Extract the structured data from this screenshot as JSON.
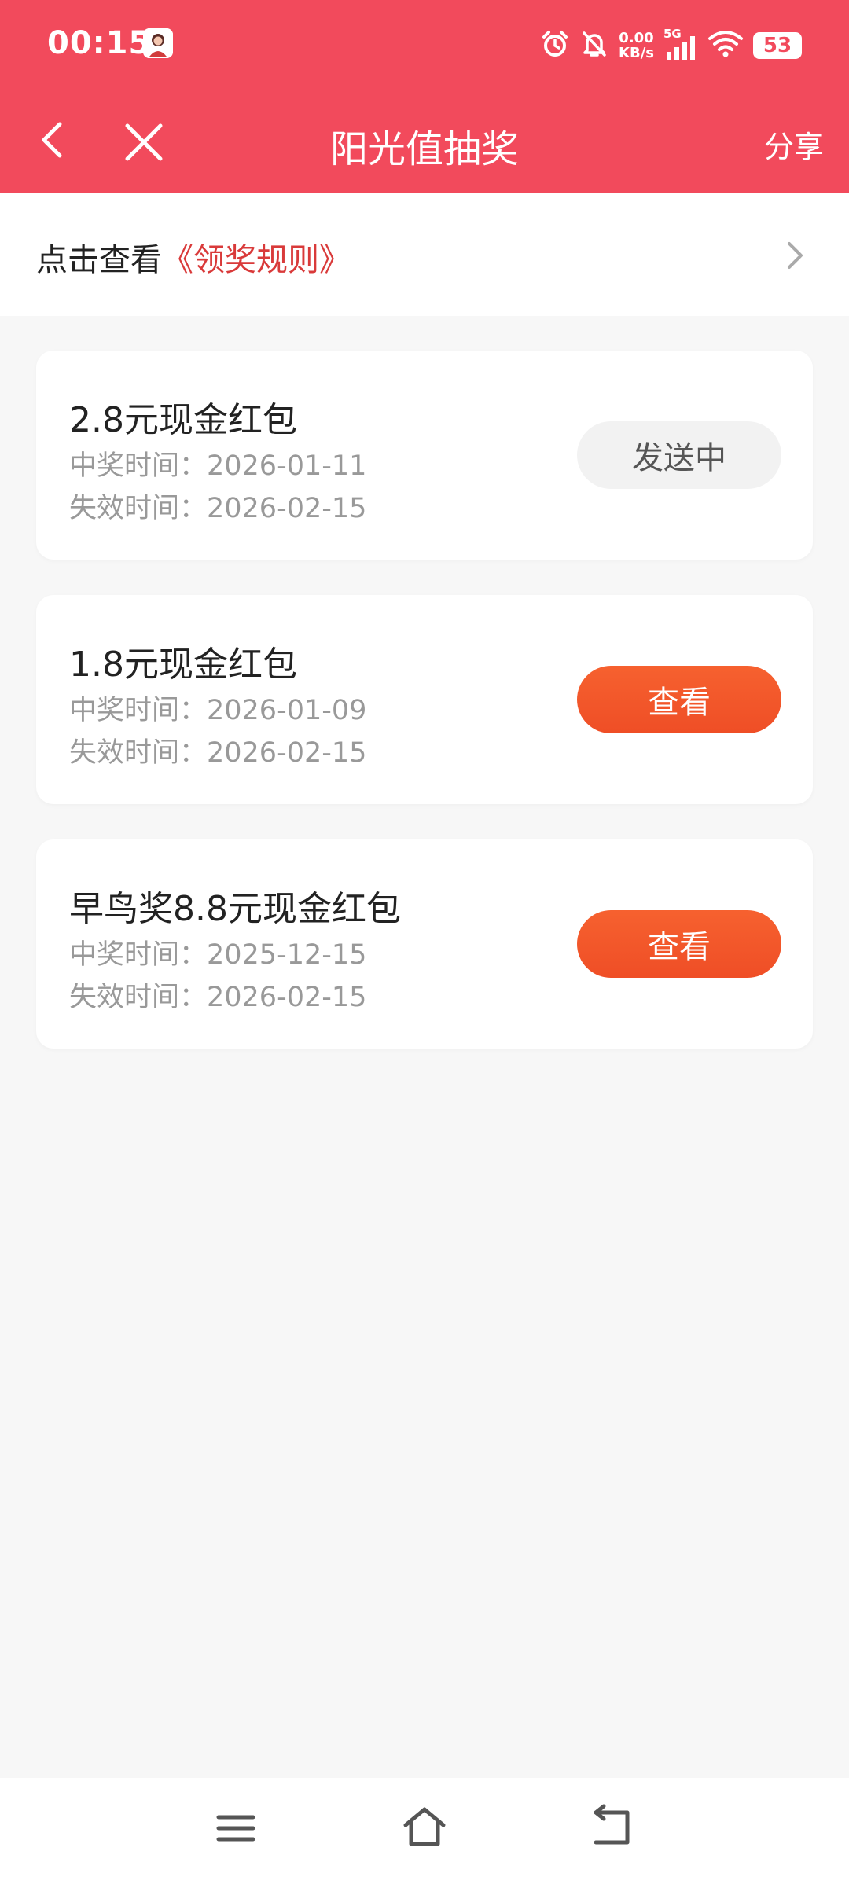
{
  "status_bar": {
    "time": "00:15",
    "net_speed_value": "0.00",
    "net_speed_unit": "KB/s",
    "network_type": "5G",
    "battery": "53"
  },
  "nav": {
    "title": "阳光值抽奖",
    "share_label": "分享"
  },
  "rules": {
    "prefix": "点击查看",
    "link": "《领奖规则》"
  },
  "prizes": [
    {
      "title": "2.8元现金红包",
      "won_time": "中奖时间：2026-01-11",
      "expire_time": "失效时间：2026-02-15",
      "button_label": "发送中"
    },
    {
      "title": "1.8元现金红包",
      "won_time": "中奖时间：2026-01-09",
      "expire_time": "失效时间：2026-02-15",
      "button_label": "查看"
    },
    {
      "title": "早鸟奖8.8元现金红包",
      "won_time": "中奖时间：2025-12-15",
      "expire_time": "失效时间：2026-02-15",
      "button_label": "查看"
    }
  ],
  "colors": {
    "header_bg": "#f24a5c",
    "link_red": "#d93a3a",
    "button_orange": "#ef4e26",
    "page_bg": "#f7f7f7"
  },
  "icons": {
    "back": "chevron-left-icon",
    "close": "close-icon",
    "rules_arrow": "chevron-right-icon",
    "sys_menu": "menu-icon",
    "sys_home": "home-icon",
    "sys_back": "return-icon"
  }
}
